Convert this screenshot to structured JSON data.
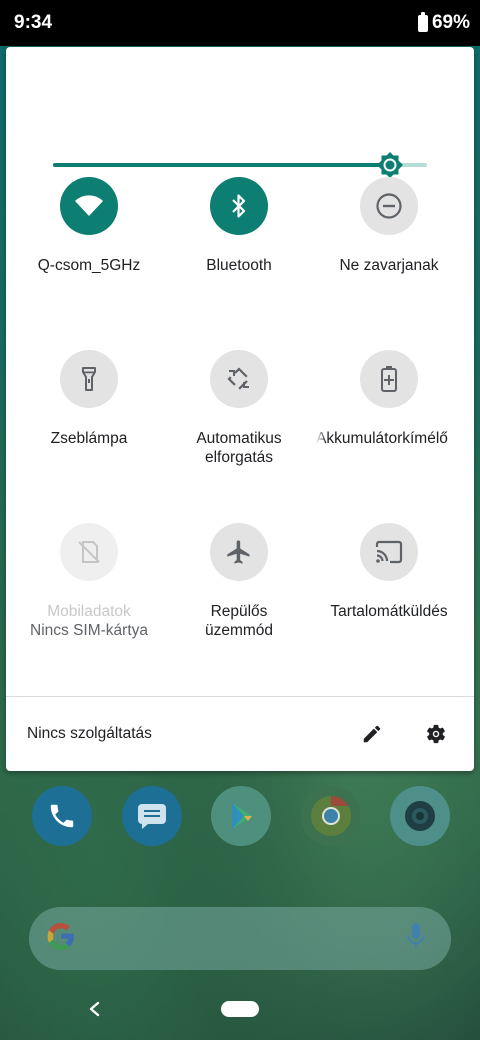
{
  "status_bar": {
    "time": "9:34",
    "battery": "69%"
  },
  "quick_settings": {
    "brightness_level": 0.9,
    "accent_color": "#0c7f72",
    "tiles": [
      {
        "label": "Q-csom_5GHz",
        "icon": "wifi-icon",
        "state": "active"
      },
      {
        "label": "Bluetooth",
        "icon": "bluetooth-icon",
        "state": "active"
      },
      {
        "label": "Ne zavarjanak",
        "icon": "do-not-disturb-icon",
        "state": "inactive"
      },
      {
        "label": "Zseblámpa",
        "icon": "flashlight-icon",
        "state": "inactive"
      },
      {
        "label": "Automatikus",
        "sublabel": "elforgatás",
        "icon": "auto-rotate-icon",
        "state": "inactive"
      },
      {
        "label": "Akkumulátorkímélő",
        "icon": "battery-saver-icon",
        "state": "inactive"
      },
      {
        "label": "Mobiladatok",
        "sublabel": "Nincs SIM-kártya",
        "icon": "no-sim-icon",
        "state": "disabled"
      },
      {
        "label": "Repülős",
        "sublabel": "üzemmód",
        "icon": "airplane-icon",
        "state": "inactive"
      },
      {
        "label": "Tartalomátküldés",
        "icon": "cast-icon",
        "state": "inactive"
      }
    ],
    "footer": {
      "carrier_text": "Nincs szolgáltatás",
      "edit_icon": "pencil-icon",
      "settings_icon": "gear-icon"
    }
  },
  "home": {
    "dock_apps": [
      "phone-icon",
      "messages-icon",
      "play-store-icon",
      "chrome-icon",
      "camera-icon"
    ],
    "search_icons": [
      "google-logo",
      "microphone-icon"
    ]
  }
}
